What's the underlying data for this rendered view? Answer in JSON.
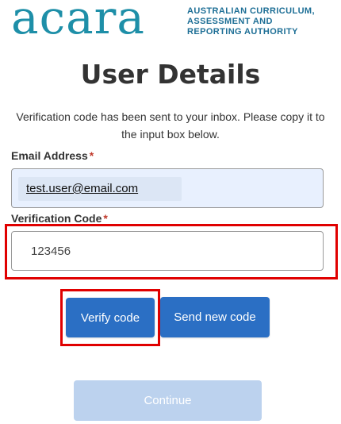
{
  "logo": {
    "mark": "acara",
    "lines": [
      "AUSTRALIAN CURRICULUM,",
      "ASSESSMENT AND",
      "REPORTING AUTHORITY"
    ]
  },
  "page": {
    "title": "User Details",
    "intro": "Verification code has been sent to your inbox. Please copy it to the input box below."
  },
  "email": {
    "label": "Email Address",
    "required_mark": "*",
    "value": "test.user@email.com"
  },
  "verification": {
    "label": "Verification Code",
    "required_mark": "*",
    "value": "123456"
  },
  "buttons": {
    "verify": "Verify code",
    "send_new": "Send new code",
    "continue": "Continue"
  },
  "colors": {
    "brand_teal": "#1e8fa8",
    "primary_button": "#2b6fc4",
    "disabled_button": "#bcd2ee",
    "highlight_outline": "#e00000"
  }
}
